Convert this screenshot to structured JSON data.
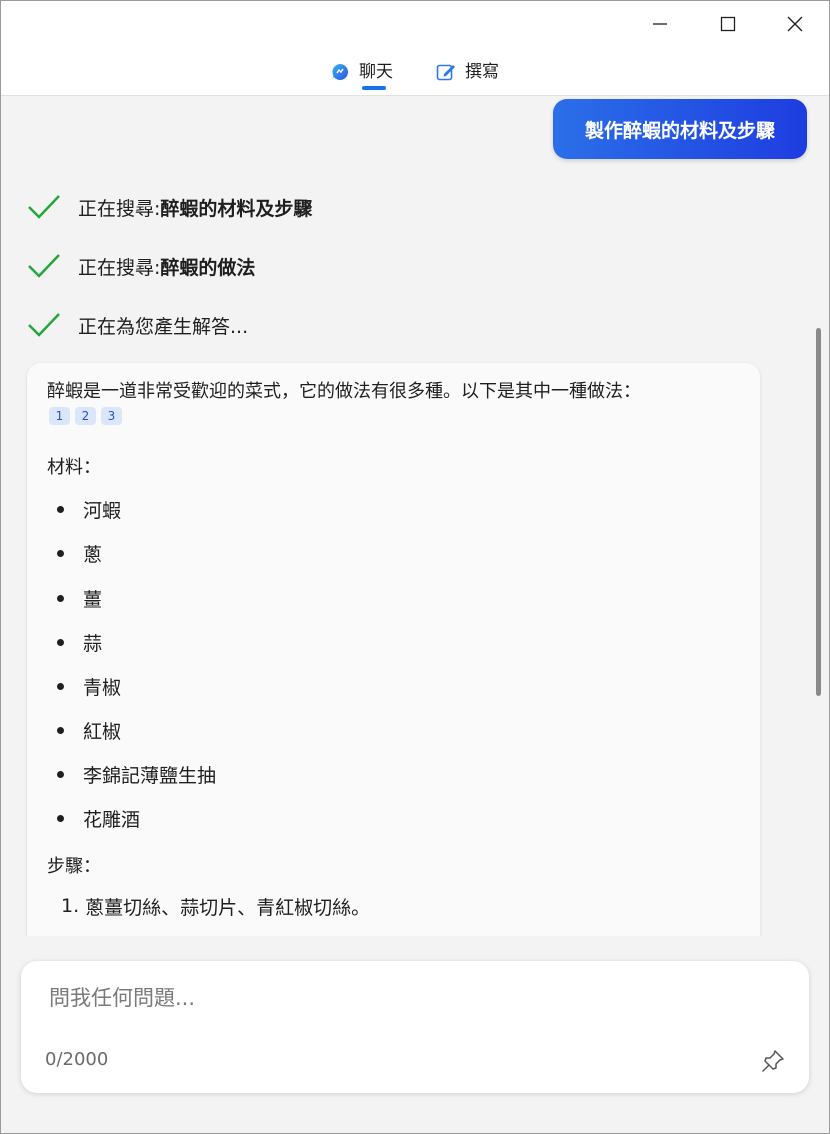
{
  "window": {
    "controls": [
      "minimize-icon",
      "maximize-icon",
      "close-icon"
    ]
  },
  "tabs": [
    {
      "label": "聊天",
      "icon": "chat-bubble-icon",
      "active": true
    },
    {
      "label": "撰寫",
      "icon": "compose-icon",
      "active": false
    }
  ],
  "colors": {
    "accent": "#1a73e8",
    "bubble_start": "#2b6fe8",
    "bubble_end": "#1e3de0",
    "check": "#22a83a"
  },
  "user_message": "製作醉蝦的材料及步驟",
  "status": [
    {
      "prefix": "正在搜尋: ",
      "query": "醉蝦的材料及步驟"
    },
    {
      "prefix": "正在搜尋: ",
      "query": "醉蝦的做法"
    },
    {
      "prefix": "正在為您產生解答...",
      "query": ""
    }
  ],
  "answer": {
    "intro": "醉蝦是一道非常受歡迎的菜式，它的做法有很多種。以下是其中一種做法：",
    "citations": [
      "1",
      "2",
      "3"
    ],
    "ingredients_label": "材料：",
    "ingredients": [
      "河蝦",
      "蔥",
      "薑",
      "蒜",
      "青椒",
      "紅椒",
      "李錦記薄鹽生抽",
      "花雕酒"
    ],
    "steps_label": "步驟：",
    "steps": [
      {
        "num": "1.",
        "text": "蔥薑切絲、蒜切片、青紅椒切絲。"
      }
    ]
  },
  "input": {
    "placeholder": "問我任何問題...",
    "value": "",
    "counter": "0/2000",
    "pin_icon": "pin-icon"
  }
}
